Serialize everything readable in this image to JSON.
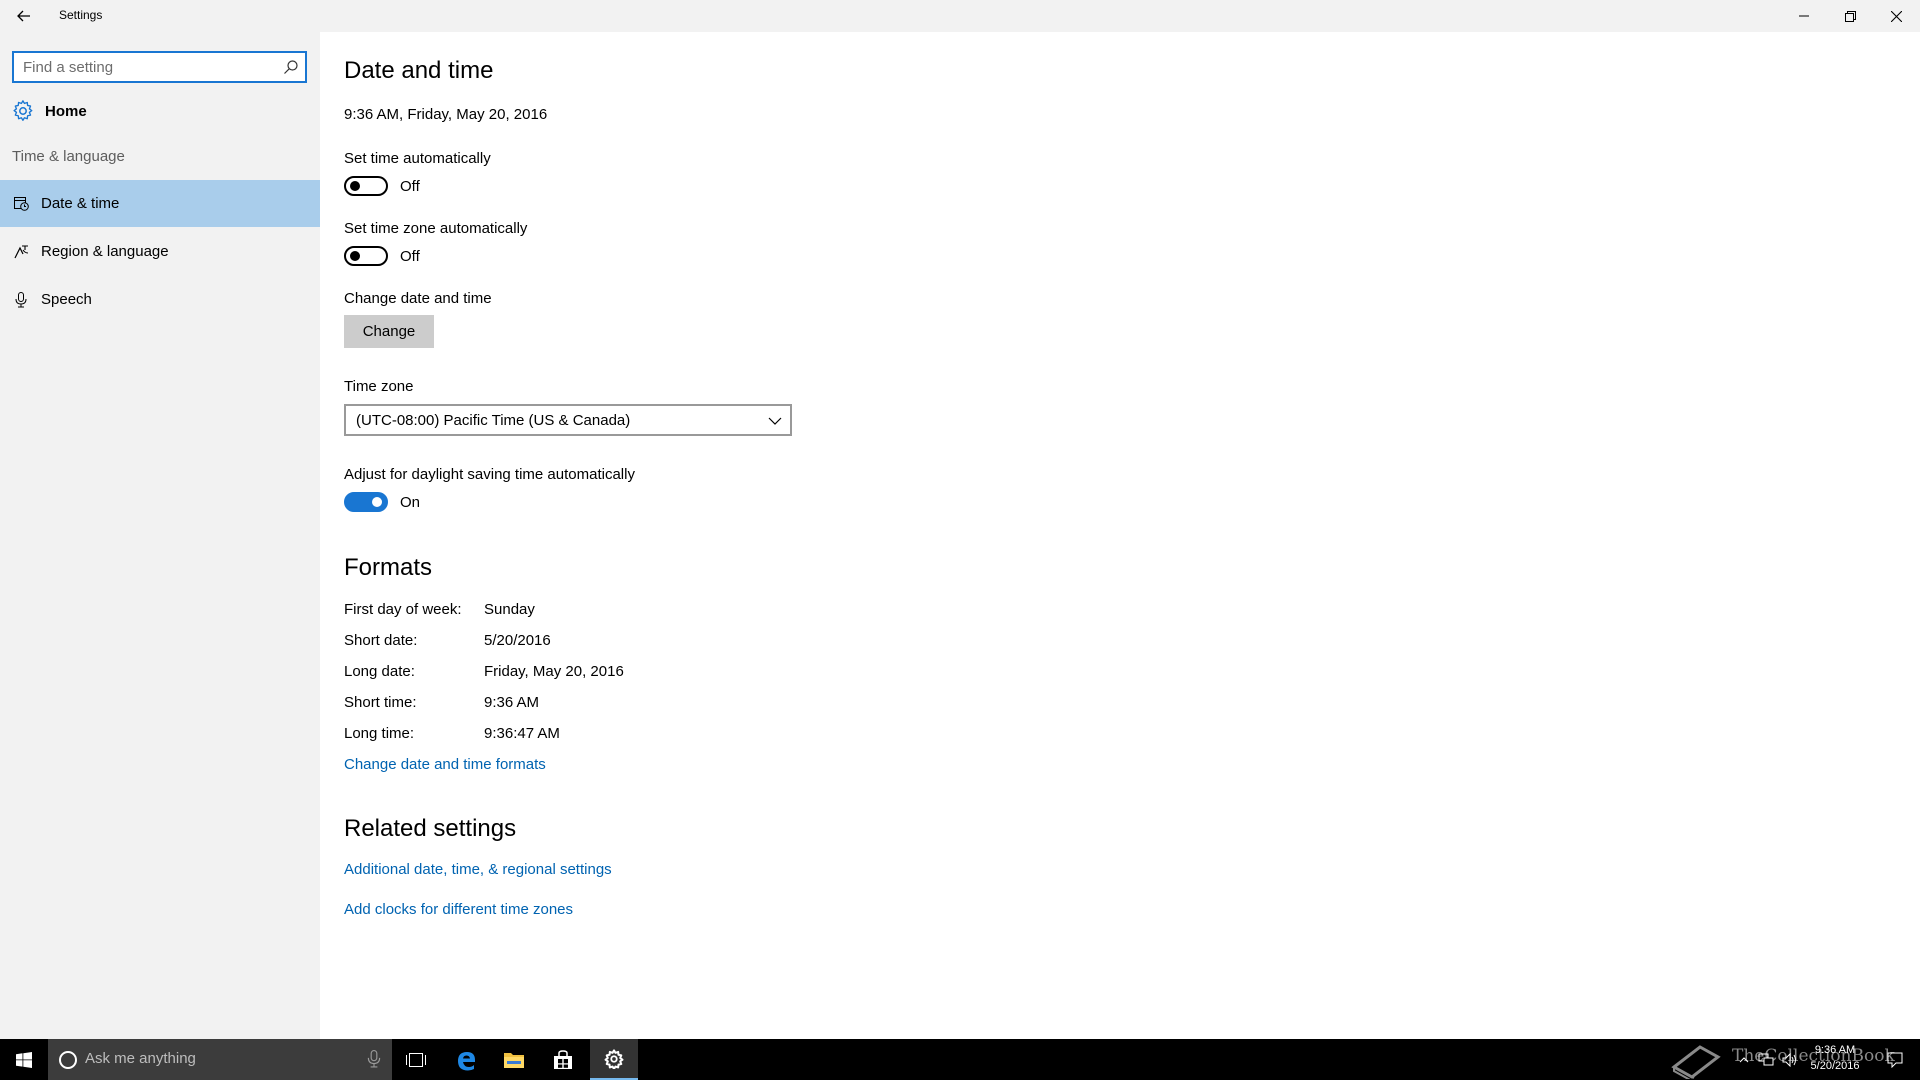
{
  "window": {
    "title": "Settings"
  },
  "sidebar": {
    "search_placeholder": "Find a setting",
    "home_label": "Home",
    "section_label": "Time & language",
    "items": [
      {
        "label": "Date & time",
        "icon": "calendar-clock-icon",
        "active": true
      },
      {
        "label": "Region & language",
        "icon": "region-language-icon",
        "active": false
      },
      {
        "label": "Speech",
        "icon": "microphone-icon",
        "active": false
      }
    ]
  },
  "main": {
    "title": "Date and time",
    "current_datetime": "9:36 AM, Friday, May 20, 2016",
    "set_time_auto": {
      "label": "Set time automatically",
      "state": "Off"
    },
    "set_timezone_auto": {
      "label": "Set time zone automatically",
      "state": "Off"
    },
    "change_date": {
      "label": "Change date and time",
      "button": "Change"
    },
    "time_zone": {
      "label": "Time zone",
      "value": "(UTC-08:00) Pacific Time (US & Canada)"
    },
    "daylight": {
      "label": "Adjust for daylight saving time automatically",
      "state": "On"
    },
    "formats": {
      "title": "Formats",
      "rows": [
        {
          "label": "First day of week:",
          "value": "Sunday"
        },
        {
          "label": "Short date:",
          "value": "5/20/2016"
        },
        {
          "label": "Long date:",
          "value": "Friday, May 20, 2016"
        },
        {
          "label": "Short time:",
          "value": "9:36 AM"
        },
        {
          "label": "Long time:",
          "value": "9:36:47 AM"
        }
      ],
      "link": "Change date and time formats"
    },
    "related": {
      "title": "Related settings",
      "links": [
        "Additional date, time, & regional settings",
        "Add clocks for different time zones"
      ]
    }
  },
  "taskbar": {
    "search_placeholder": "Ask me anything",
    "clock_time": "9:36 AM",
    "clock_date": "5/20/2016",
    "watermark": "TheCollectionBook"
  },
  "colors": {
    "accent": "#1976d2",
    "nav_active": "#a9cdeb",
    "link": "#0063b1",
    "sidebar_bg": "#f2f2f2",
    "taskbar_bg": "#000000"
  }
}
